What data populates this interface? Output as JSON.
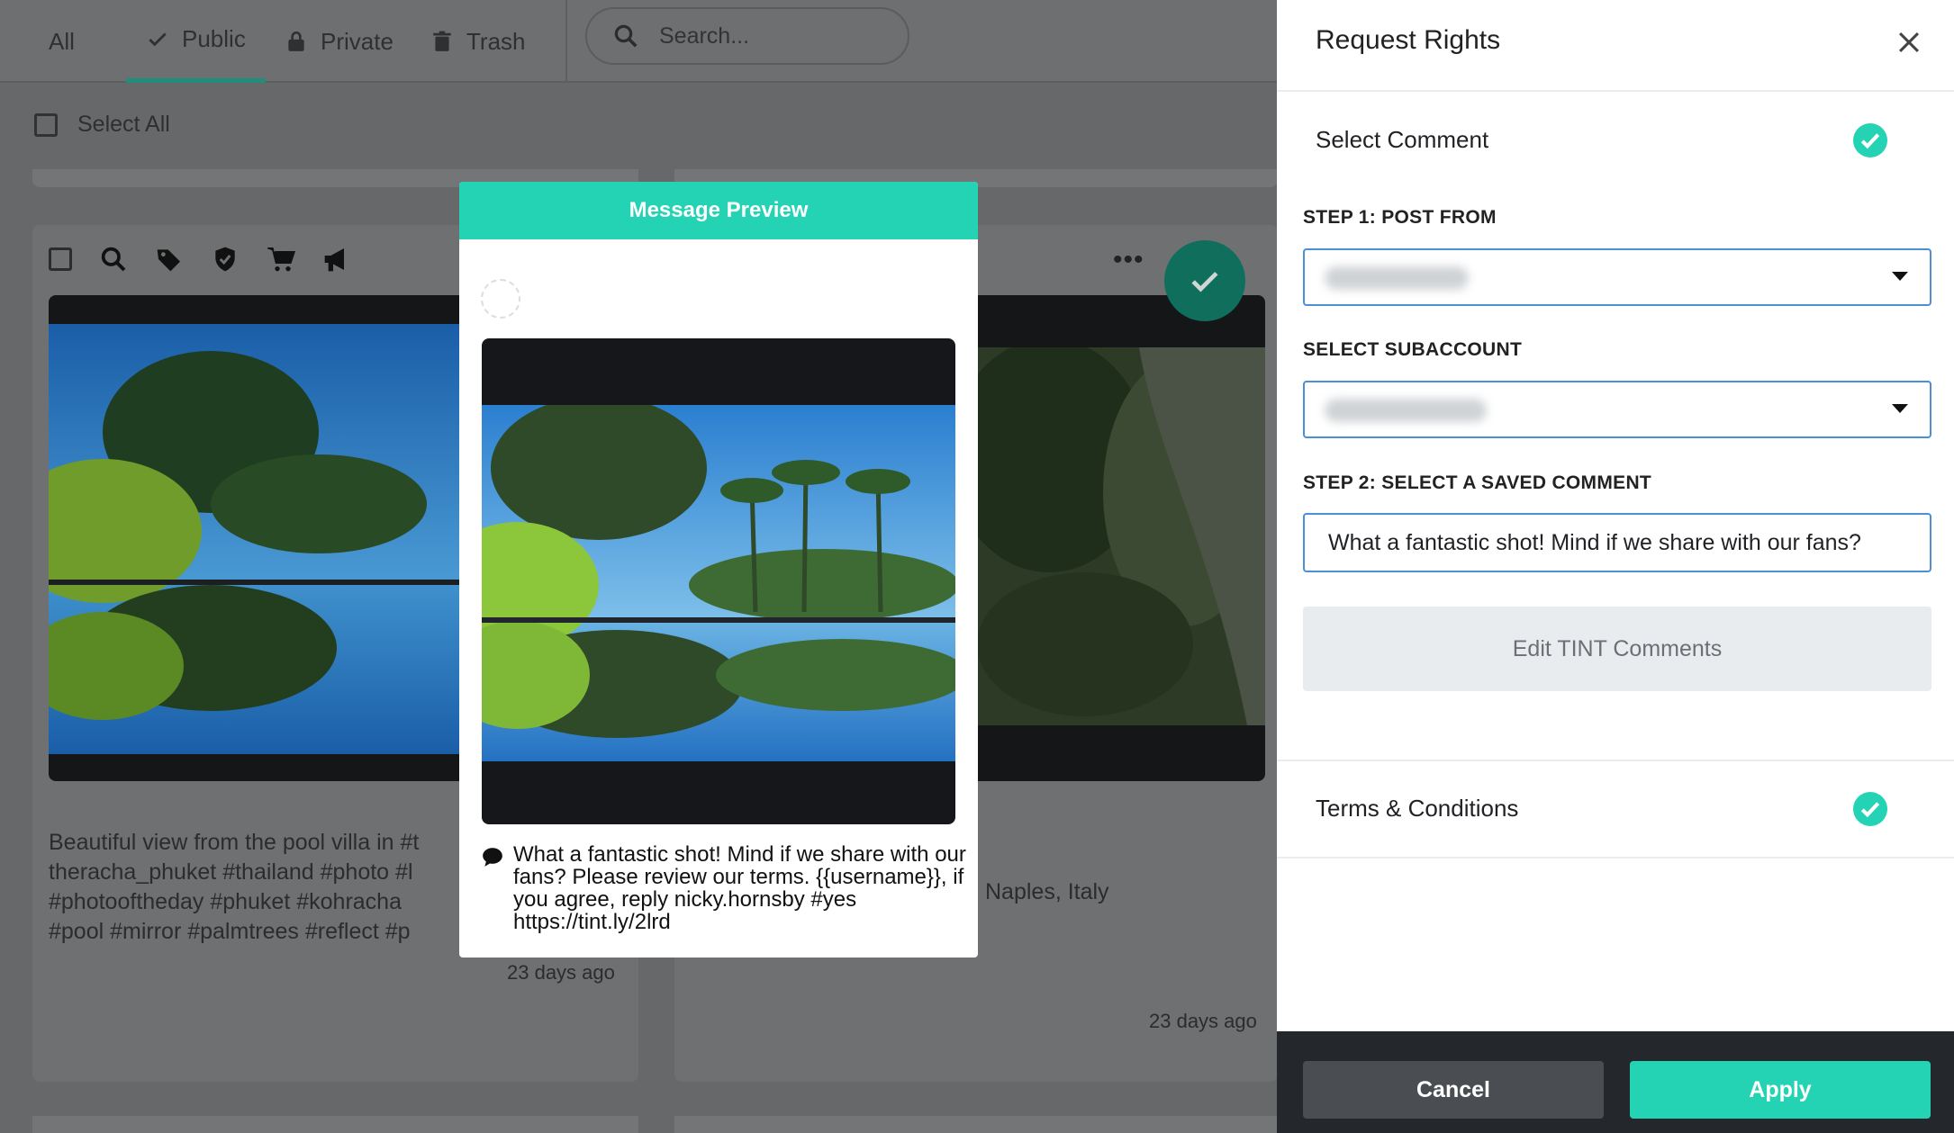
{
  "tabs": [
    {
      "label": "All",
      "icon": "none"
    },
    {
      "label": "Public",
      "icon": "check-icon",
      "active": true
    },
    {
      "label": "Private",
      "icon": "lock-icon"
    },
    {
      "label": "Trash",
      "icon": "trash-icon"
    }
  ],
  "search": {
    "placeholder": "Search..."
  },
  "select_all": {
    "label": "Select All"
  },
  "cards": [
    {
      "caption": [
        "Beautiful view from the pool villa in #t",
        "theracha_phuket #thailand #photo #l",
        "#photooftheday #phuket #kohracha",
        "#pool #mirror #palmtrees #reflect #p"
      ],
      "time": "23 days ago"
    },
    {
      "caption": [
        "Naples, Italy"
      ],
      "time": "23 days ago"
    }
  ],
  "modal": {
    "title": "Message Preview",
    "message": "What a fantastic shot! Mind if we share with our fans? Please review our terms. {{username}}, if you agree, reply nicky.hornsby #yes https://tint.ly/2lrd"
  },
  "panel": {
    "title": "Request Rights",
    "select_comment": "Select Comment",
    "step1_label": "STEP 1: POST FROM",
    "subaccount_label": "SELECT SUBACCOUNT",
    "step2_label": "STEP 2: SELECT A SAVED COMMENT",
    "comment_value": "What a fantastic shot! Mind if we share with our fans?",
    "edit_button": "Edit TINT Comments",
    "terms": "Terms & Conditions",
    "cancel": "Cancel",
    "apply": "Apply"
  },
  "colors": {
    "accent": "#23d3b3",
    "input_border": "#4b90d6",
    "footer": "#24282c"
  }
}
